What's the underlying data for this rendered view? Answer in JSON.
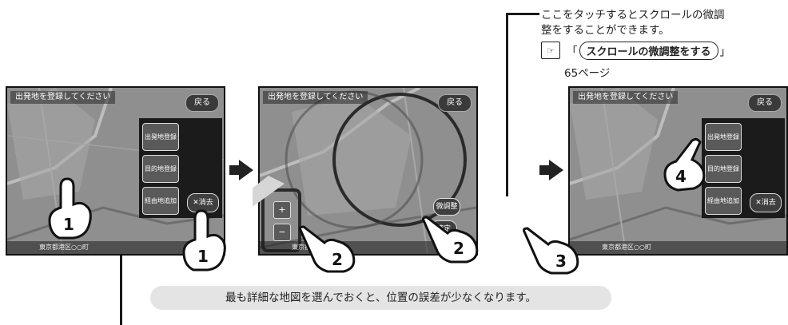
{
  "note": {
    "line1": "ここをタッチするとスクロールの微調",
    "line2": "整をすることができます。",
    "ref_icon_label": "☞",
    "ref_open": "「",
    "ref_title": "スクロールの微調整をする",
    "ref_close": "」",
    "page_ref": "65ページ"
  },
  "screens": [
    {
      "title": "出発地を登録してください",
      "back_label": "戻る",
      "status": "東京都港区○○町",
      "menu": [
        "出発地登録",
        "目的地登録",
        "経由地追加"
      ],
      "delete_label": "✕消去"
    },
    {
      "title": "出発地を登録してください",
      "back_label": "戻る",
      "status": "東京都港区○○町",
      "zoom_in_label": "+",
      "zoom_out_label": "−",
      "fine_adjust_label": "微調整",
      "small_label": "確定"
    },
    {
      "title": "出発地を登録してください",
      "back_label": "戻る",
      "status": "東京都港区○○町",
      "menu": [
        "出発地登録",
        "目的地登録",
        "経由地追加"
      ],
      "delete_label": "✕消去"
    }
  ],
  "step_numbers": [
    "1",
    "1",
    "2",
    "2",
    "3",
    "4"
  ],
  "info_text": "最も詳細な地図を選んでおくと、位置の誤差が少なくなります。",
  "colors": {
    "map_gray": "#8a8a8a",
    "panel_dark": "#1b1b1b",
    "info_bg": "#e4e4e4",
    "line": "#1a1a1a"
  }
}
